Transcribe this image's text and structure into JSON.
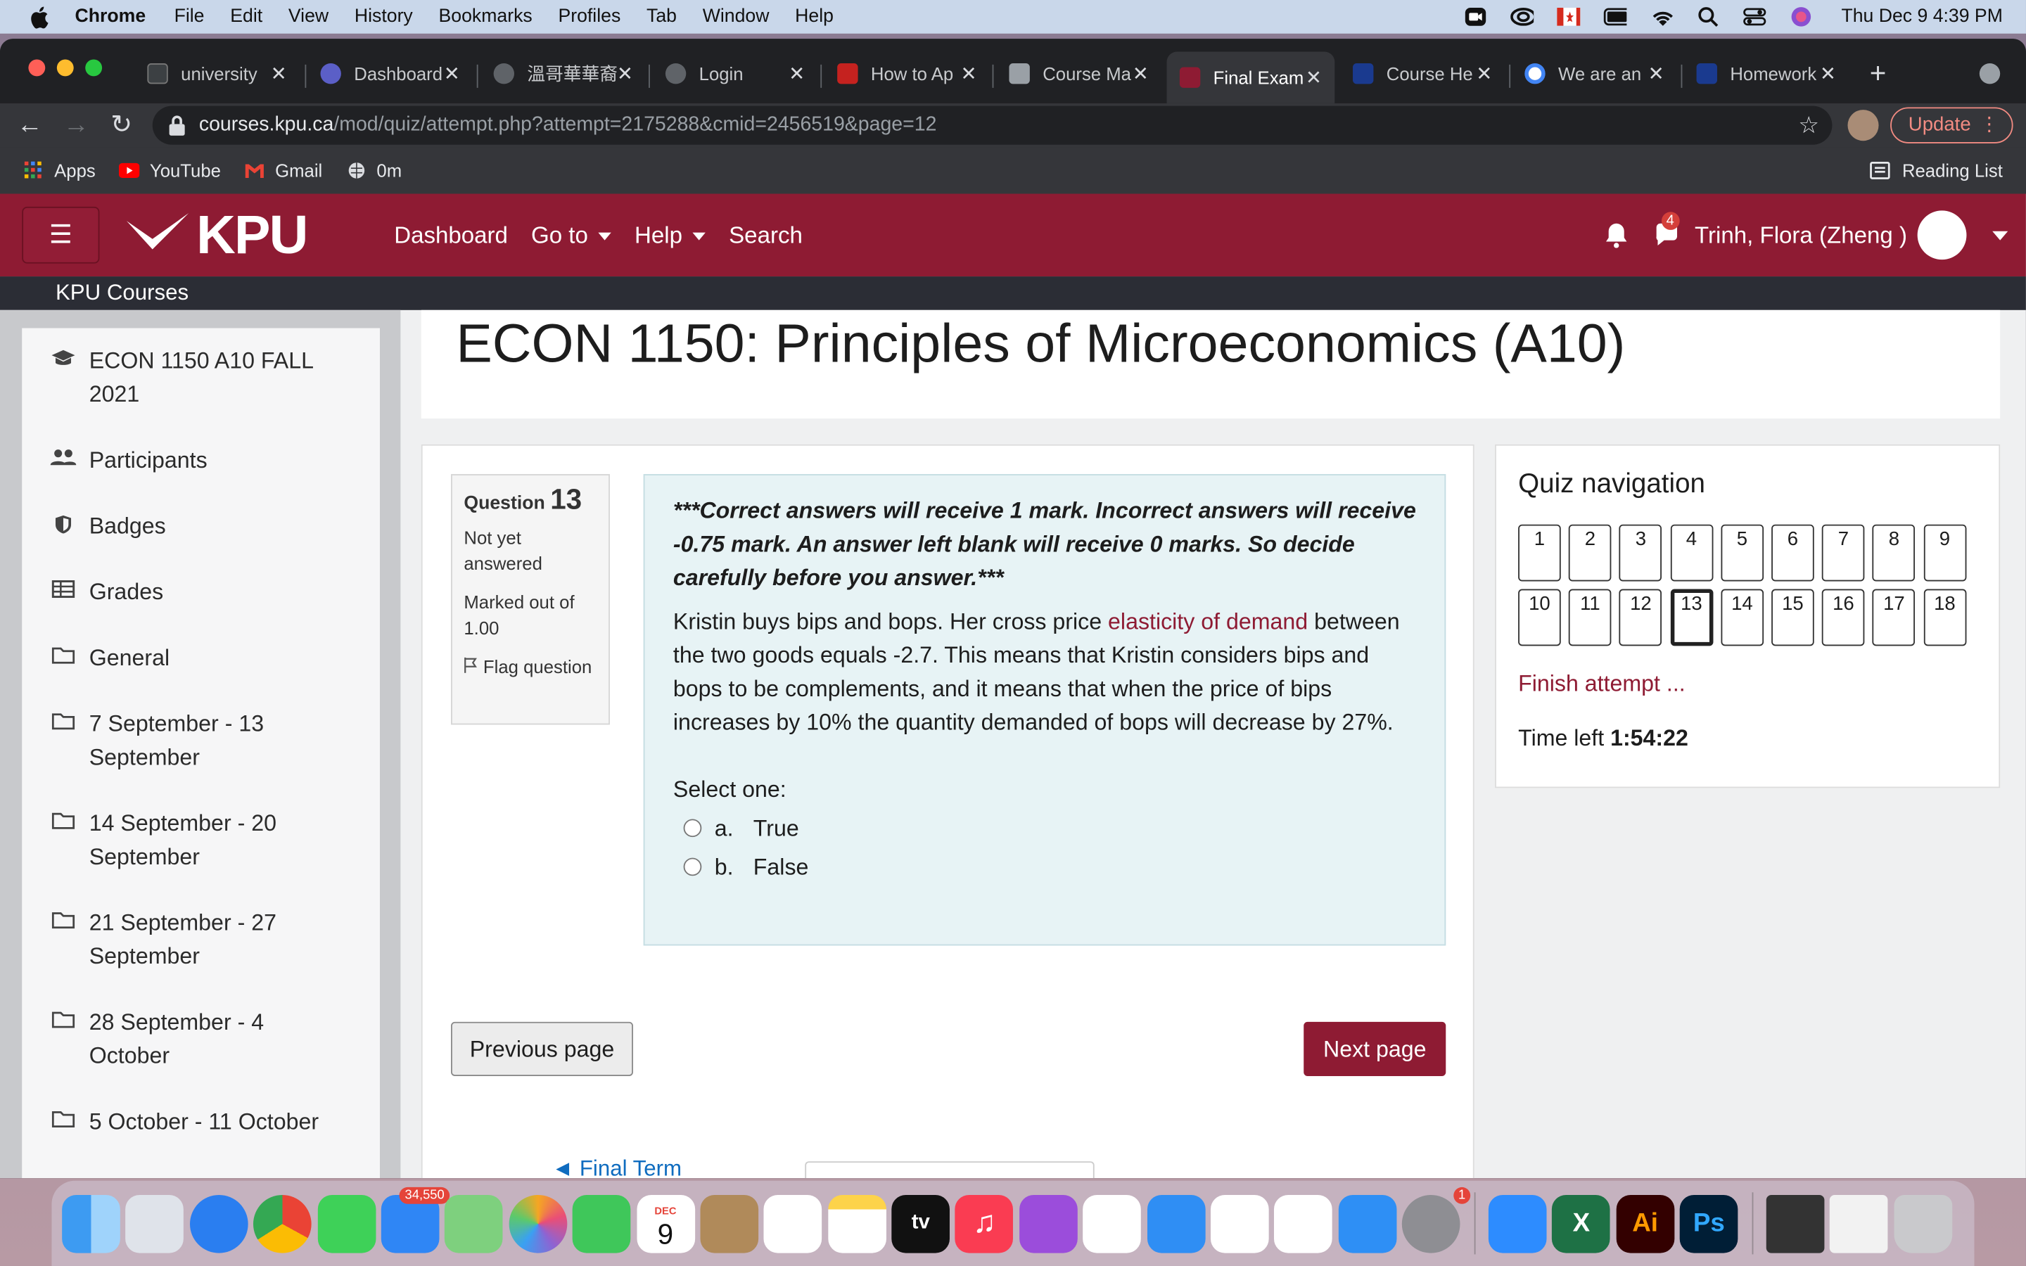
{
  "menubar": {
    "app": "Chrome",
    "items": [
      "File",
      "Edit",
      "View",
      "History",
      "Bookmarks",
      "Profiles",
      "Tab",
      "Window",
      "Help"
    ],
    "clock": "Thu Dec 9  4:39 PM"
  },
  "tabs": [
    {
      "label": "university",
      "color": "#3c4043"
    },
    {
      "label": "Dashboard",
      "color": "#5b5fc7"
    },
    {
      "label": "溫哥華華裔",
      "color": "#5f6368"
    },
    {
      "label": "Login",
      "color": "#5f6368"
    },
    {
      "label": "How to Ap",
      "color": "#c5221f"
    },
    {
      "label": "Course Ma",
      "color": "#9aa0a6"
    },
    {
      "label": "Final Exam",
      "color": "#8e1b33"
    },
    {
      "label": "Course He",
      "color": "#1a3a8f"
    },
    {
      "label": "We are an",
      "color": "#ffffff"
    },
    {
      "label": "Homework",
      "color": "#1a3a8f"
    }
  ],
  "address": {
    "host": "courses.kpu.ca",
    "path": "/mod/quiz/attempt.php?attempt=2175288&cmid=2456519&page=12"
  },
  "update_label": "Update",
  "bookmarks": [
    "Apps",
    "YouTube",
    "Gmail",
    "0m"
  ],
  "reading_list": "Reading List",
  "moodle": {
    "logo": "KPU",
    "nav": {
      "dashboard": "Dashboard",
      "goto": "Go to",
      "help": "Help",
      "search": "Search"
    },
    "notif_count": "4",
    "user": "Trinh, Flora (Zheng )",
    "course_bar": "KPU Courses",
    "sidebar": [
      "ECON 1150 A10 FALL 2021",
      "Participants",
      "Badges",
      "Grades",
      "General",
      "7 September - 13 September",
      "14 September - 20 September",
      "21 September - 27 September",
      "28 September - 4 October",
      "5 October - 11 October"
    ],
    "page_title": "ECON 1150: Principles of Microeconomics (A10)"
  },
  "question": {
    "label": "Question",
    "number": "13",
    "status": "Not yet answered",
    "marked": "Marked out of 1.00",
    "flag": "Flag question",
    "warning": "***Correct answers will receive 1 mark.  Incorrect answers will receive -0.75 mark.  An answer left blank will receive 0 marks.  So decide carefully before you answer.***",
    "text_before": "Kristin buys bips and bops.  Her cross price ",
    "text_link": "elasticity of demand",
    "text_after": " between the two goods equals -2.7.  This means that Kristin considers bips and bops to be complements, and it means that when the price of bips increases by 10% the quantity demanded of bops will decrease by 27%.",
    "select_one": "Select one:",
    "options": [
      {
        "letter": "a.",
        "text": "True"
      },
      {
        "letter": "b.",
        "text": "False"
      }
    ]
  },
  "buttons": {
    "prev": "Previous page",
    "next": "Next page"
  },
  "prev_activity": "◄ Final Term",
  "quiz_nav": {
    "title": "Quiz navigation",
    "numbers": [
      "1",
      "2",
      "3",
      "4",
      "5",
      "6",
      "7",
      "8",
      "9",
      "10",
      "11",
      "12",
      "13",
      "14",
      "15",
      "16",
      "17",
      "18"
    ],
    "current": "13",
    "finish": "Finish attempt ...",
    "time_label": "Time left ",
    "time_value": "1:54:22"
  },
  "dock": {
    "mail_badge": "34,550",
    "calendar_month": "DEC",
    "calendar_day": "9",
    "settings_badge": "1",
    "tv_label": "tv",
    "ai_label": "Ai",
    "ps_label": "Ps"
  },
  "colors": {
    "brand": "#8e1b33",
    "link": "#0f6cbf",
    "question_bg": "#e7f3f5"
  }
}
